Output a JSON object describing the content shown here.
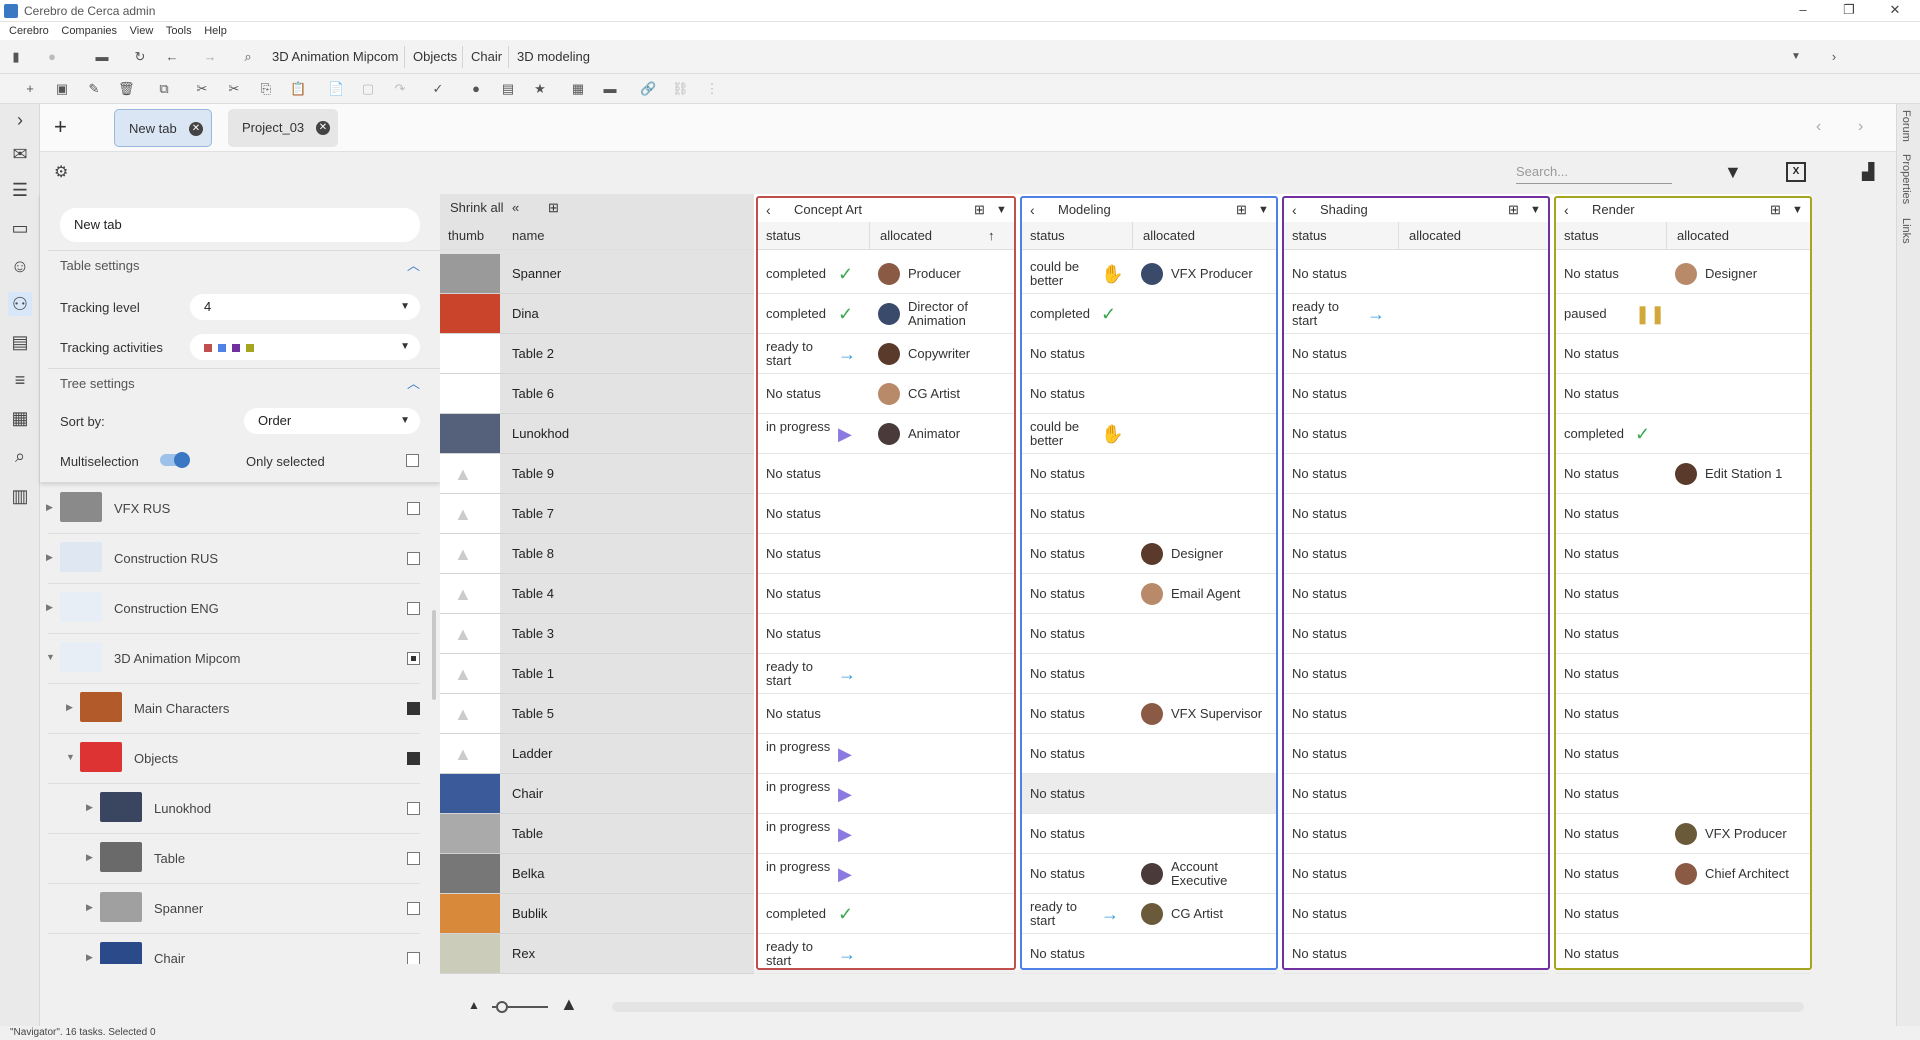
{
  "window": {
    "title": "Cerebro de Cerca  admin"
  },
  "menu": [
    "Cerebro",
    "Companies",
    "View",
    "Tools",
    "Help"
  ],
  "breadcrumb": [
    "3D Animation Mipcom",
    "Objects",
    "Chair",
    "3D modeling"
  ],
  "tabs": [
    {
      "label": "New tab"
    },
    {
      "label": "Project_03"
    }
  ],
  "search": {
    "placeholder": "Search..."
  },
  "right_rail": [
    "Forum",
    "Properties",
    "Links"
  ],
  "panel": {
    "tab_name_value": "New tab",
    "table_settings_label": "Table settings",
    "tracking_level_label": "Tracking level",
    "tracking_level_value": "4",
    "tracking_activities_label": "Tracking activities",
    "tracking_colors": [
      "#c0504d",
      "#4f81e6",
      "#7030a0",
      "#a5a520"
    ],
    "tree_settings_label": "Tree settings",
    "sort_by_label": "Sort by:",
    "sort_by_value": "Order",
    "multiselection_label": "Multiselection",
    "only_selected_label": "Only selected"
  },
  "tree": [
    {
      "name": "VFX RUS",
      "level": 0,
      "check": "empty"
    },
    {
      "name": "Construction RUS",
      "level": 0,
      "check": "empty"
    },
    {
      "name": "Construction ENG",
      "level": 0,
      "check": "empty"
    },
    {
      "name": "3D Animation Mipcom",
      "level": 0,
      "check": "partial",
      "expanded": true
    },
    {
      "name": "Main Characters",
      "level": 1,
      "check": "filled"
    },
    {
      "name": "Objects",
      "level": 1,
      "check": "filled",
      "expanded": true
    },
    {
      "name": "Lunokhod",
      "level": 2,
      "check": "empty"
    },
    {
      "name": "Table",
      "level": 2,
      "check": "empty"
    },
    {
      "name": "Spanner",
      "level": 2,
      "check": "empty"
    },
    {
      "name": "Chair",
      "level": 2,
      "check": "empty"
    }
  ],
  "grid": {
    "shrink_all_label": "Shrink all",
    "thumb_header": "thumb",
    "name_header": "name",
    "status_header": "status",
    "allocated_header": "allocated",
    "activities": [
      {
        "name": "Concept Art",
        "color": "#c0504d"
      },
      {
        "name": "Modeling",
        "color": "#4f81e6"
      },
      {
        "name": "Shading",
        "color": "#7030a0"
      },
      {
        "name": "Render",
        "color": "#a5a520"
      }
    ],
    "rows": [
      {
        "name": "Spanner",
        "cells": [
          [
            "completed",
            "Producer"
          ],
          [
            "could be better",
            "VFX Producer"
          ],
          [
            "No status",
            ""
          ],
          [
            "No status",
            "Designer"
          ]
        ]
      },
      {
        "name": "Dina",
        "cells": [
          [
            "completed",
            "Director of Animation"
          ],
          [
            "completed",
            ""
          ],
          [
            "ready to start",
            ""
          ],
          [
            "paused",
            ""
          ]
        ]
      },
      {
        "name": "Table 2",
        "cells": [
          [
            "ready to start",
            "Copywriter"
          ],
          [
            "No status",
            ""
          ],
          [
            "No status",
            ""
          ],
          [
            "No status",
            ""
          ]
        ]
      },
      {
        "name": "Table 6",
        "cells": [
          [
            "No status",
            "CG Artist"
          ],
          [
            "No status",
            ""
          ],
          [
            "No status",
            ""
          ],
          [
            "No status",
            ""
          ]
        ]
      },
      {
        "name": "Lunokhod",
        "cells": [
          [
            "in progress",
            "Animator"
          ],
          [
            "could be better",
            ""
          ],
          [
            "No status",
            ""
          ],
          [
            "completed",
            ""
          ]
        ]
      },
      {
        "name": "Table 9",
        "cells": [
          [
            "No status",
            ""
          ],
          [
            "No status",
            ""
          ],
          [
            "No status",
            ""
          ],
          [
            "No status",
            "Edit Station 1"
          ]
        ]
      },
      {
        "name": "Table 7",
        "cells": [
          [
            "No status",
            ""
          ],
          [
            "No status",
            ""
          ],
          [
            "No status",
            ""
          ],
          [
            "No status",
            ""
          ]
        ]
      },
      {
        "name": "Table 8",
        "cells": [
          [
            "No status",
            ""
          ],
          [
            "No status",
            "Designer"
          ],
          [
            "No status",
            ""
          ],
          [
            "No status",
            ""
          ]
        ]
      },
      {
        "name": "Table 4",
        "cells": [
          [
            "No status",
            ""
          ],
          [
            "No status",
            "Email Agent"
          ],
          [
            "No status",
            ""
          ],
          [
            "No status",
            ""
          ]
        ]
      },
      {
        "name": "Table 3",
        "cells": [
          [
            "No status",
            ""
          ],
          [
            "No status",
            ""
          ],
          [
            "No status",
            ""
          ],
          [
            "No status",
            ""
          ]
        ]
      },
      {
        "name": "Table 1",
        "cells": [
          [
            "ready to start",
            ""
          ],
          [
            "No status",
            ""
          ],
          [
            "No status",
            ""
          ],
          [
            "No status",
            ""
          ]
        ]
      },
      {
        "name": "Table 5",
        "cells": [
          [
            "No status",
            ""
          ],
          [
            "No status",
            "VFX Supervisor"
          ],
          [
            "No status",
            ""
          ],
          [
            "No status",
            ""
          ]
        ]
      },
      {
        "name": "Ladder",
        "cells": [
          [
            "in progress",
            ""
          ],
          [
            "No status",
            ""
          ],
          [
            "No status",
            ""
          ],
          [
            "No status",
            ""
          ]
        ]
      },
      {
        "name": "Chair",
        "cells": [
          [
            "in progress",
            ""
          ],
          [
            "No status",
            ""
          ],
          [
            "No status",
            ""
          ],
          [
            "No status",
            ""
          ]
        ]
      },
      {
        "name": "Table",
        "cells": [
          [
            "in progress",
            ""
          ],
          [
            "No status",
            ""
          ],
          [
            "No status",
            ""
          ],
          [
            "No status",
            "VFX Producer"
          ]
        ]
      },
      {
        "name": "Belka",
        "cells": [
          [
            "in progress",
            ""
          ],
          [
            "No status",
            "Account Executive"
          ],
          [
            "No status",
            ""
          ],
          [
            "No status",
            "Chief Architect"
          ]
        ]
      },
      {
        "name": "Bublik",
        "cells": [
          [
            "completed",
            ""
          ],
          [
            "ready to start",
            "CG Artist"
          ],
          [
            "No status",
            ""
          ],
          [
            "No status",
            ""
          ]
        ]
      },
      {
        "name": "Rex",
        "cells": [
          [
            "ready to start",
            ""
          ],
          [
            "No status",
            ""
          ],
          [
            "No status",
            ""
          ],
          [
            "No status",
            ""
          ]
        ]
      }
    ]
  },
  "status_bar": "\"Navigator\". 16 tasks. Selected 0"
}
